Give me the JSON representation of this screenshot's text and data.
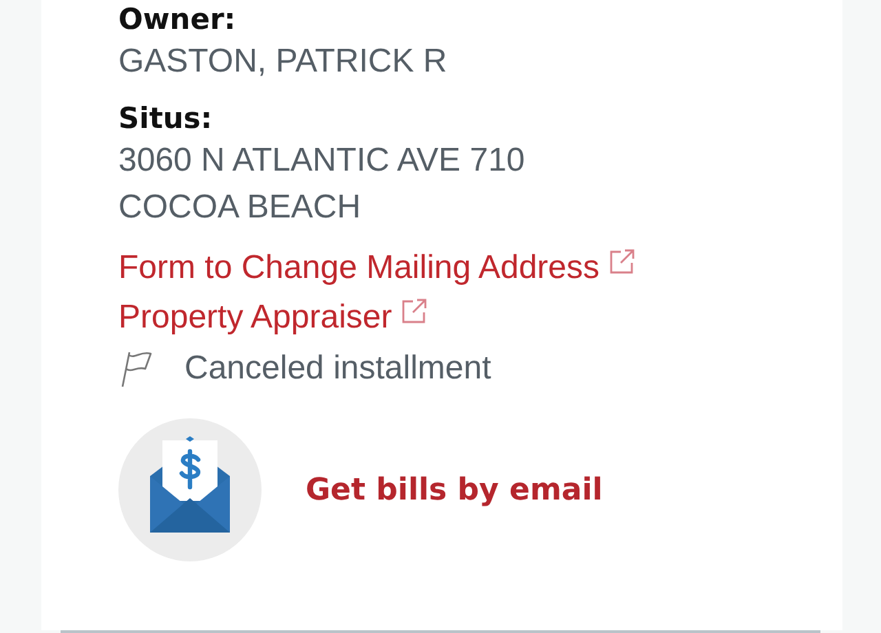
{
  "fields": [
    {
      "label": "Owner:",
      "lines": [
        "GASTON, PATRICK R"
      ]
    },
    {
      "label": "Situs:",
      "lines": [
        "3060 N ATLANTIC AVE 710",
        "COCOA BEACH"
      ]
    }
  ],
  "links": [
    {
      "text": "Form to Change Mailing Address"
    },
    {
      "text": "Property Appraiser"
    }
  ],
  "flag_note": "Canceled installment",
  "email_promo": {
    "text": "Get bills by email"
  }
}
